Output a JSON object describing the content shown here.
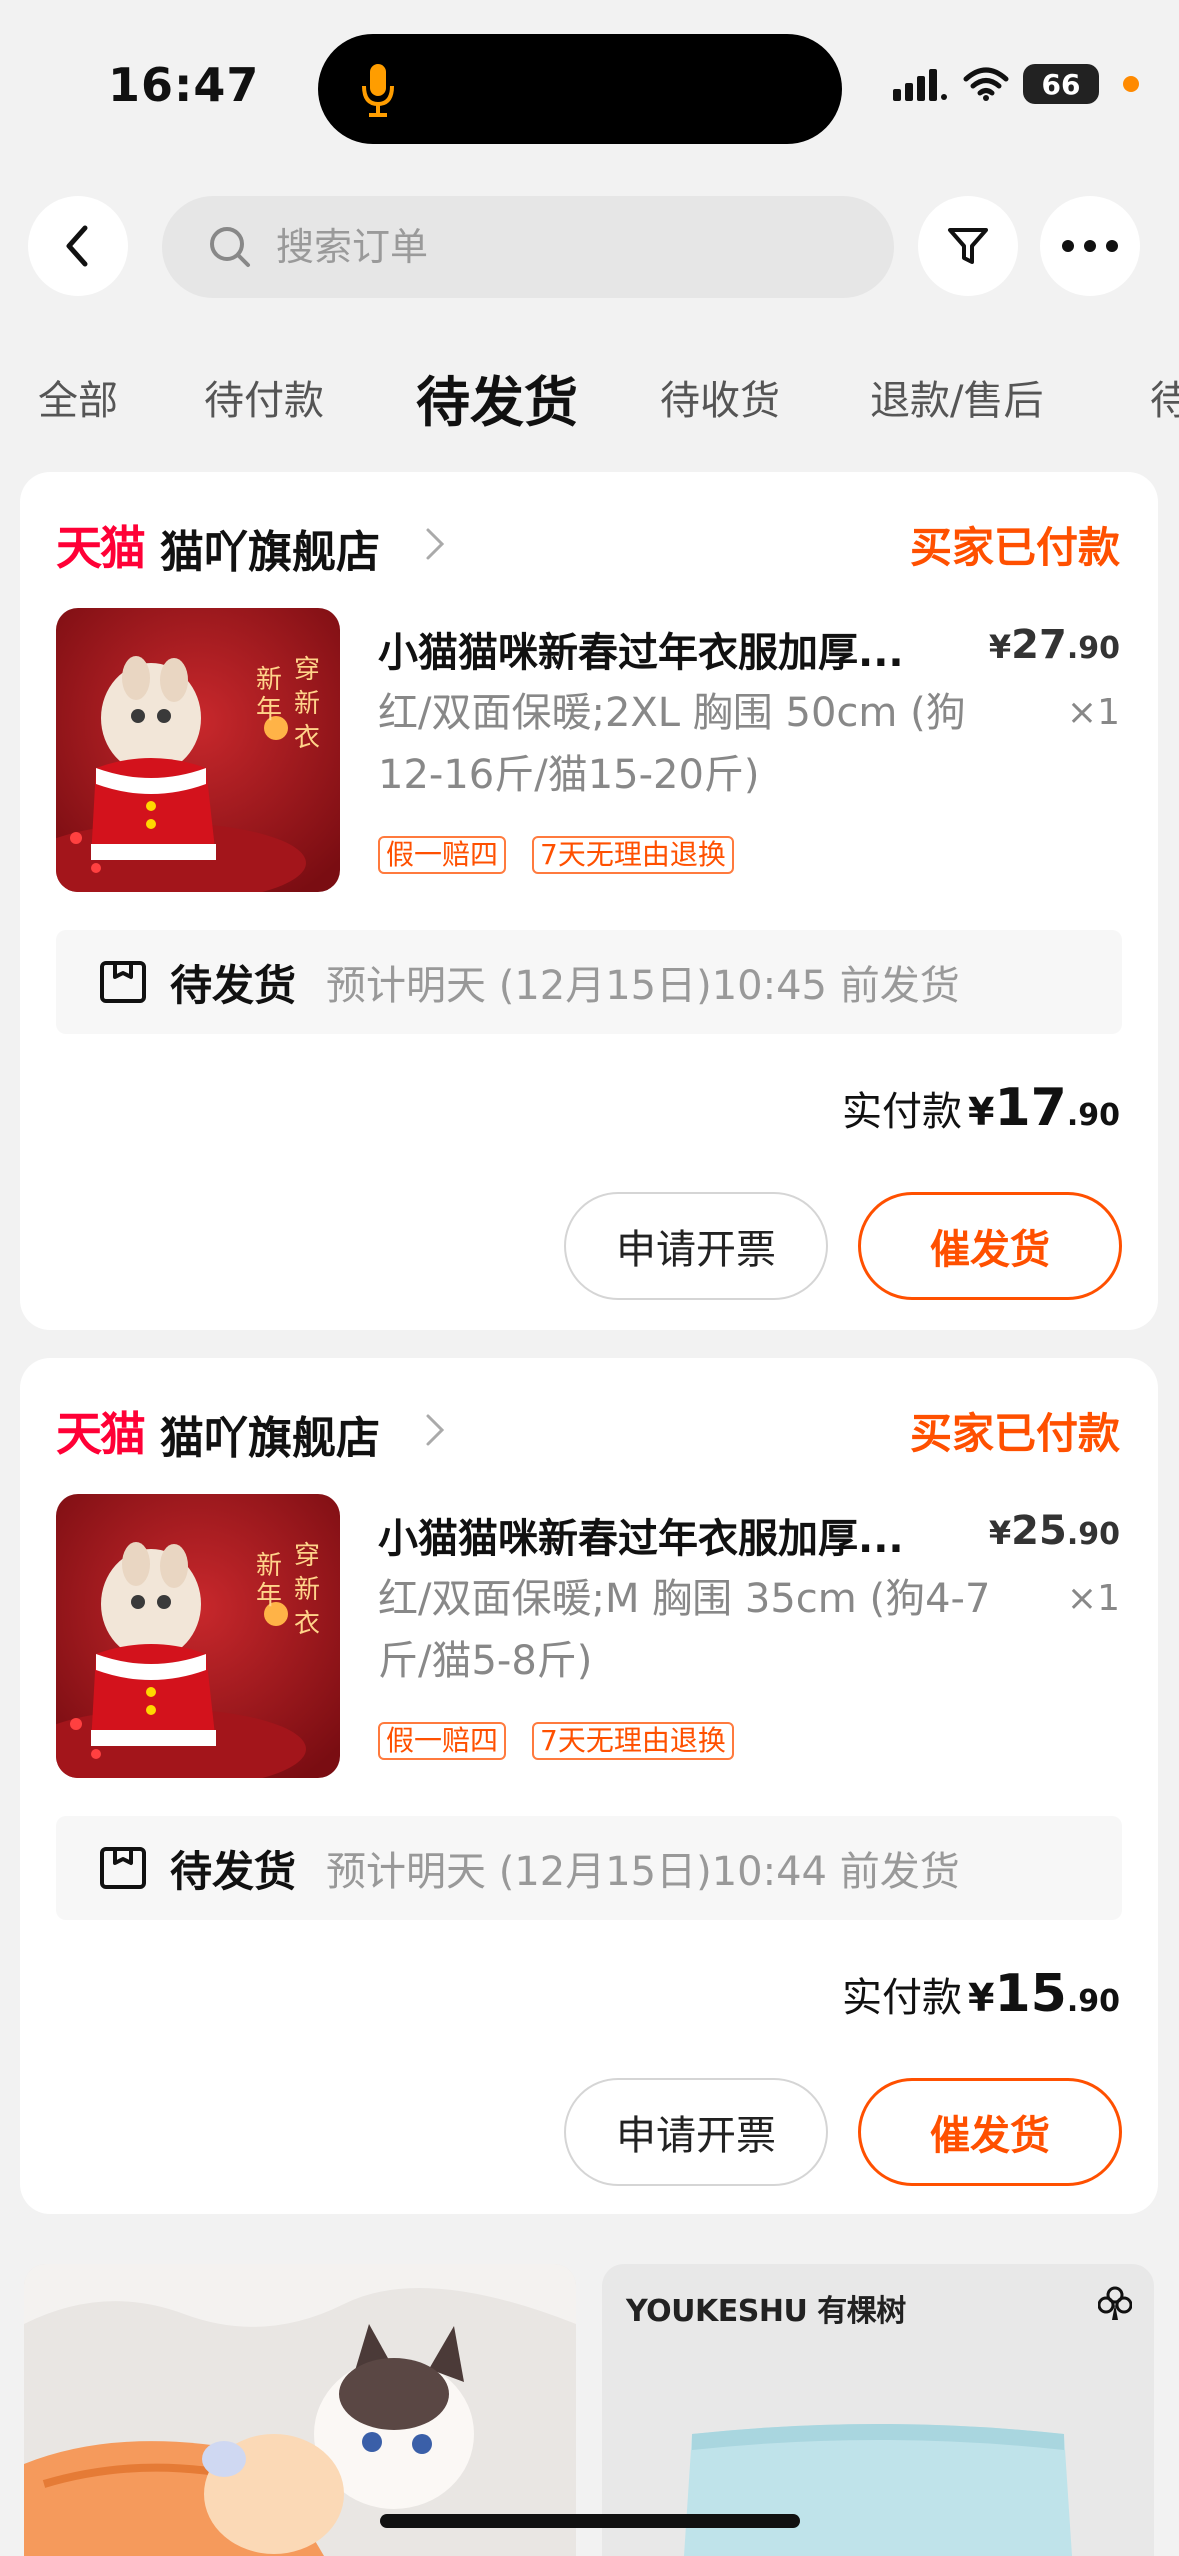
{
  "status_bar": {
    "time": "16:47",
    "battery": "66"
  },
  "search": {
    "placeholder": "搜索订单"
  },
  "tabs": [
    {
      "label": "全部"
    },
    {
      "label": "待付款"
    },
    {
      "label": "待发货"
    },
    {
      "label": "待收货"
    },
    {
      "label": "退款/售后"
    },
    {
      "label": "待"
    }
  ],
  "active_tab": "待发货",
  "orders": [
    {
      "store_logo": "天猫",
      "store_name": "猫吖旗舰店",
      "status": "买家已付款",
      "product_title": "小猫猫咪新春过年衣服加厚...",
      "price_int": "27",
      "price_dec": ".90",
      "sku": "红/双面保暖;2XL 胸围 50cm (狗12-16斤/猫15-20斤)",
      "qty": "×1",
      "tags": [
        "假一赔四",
        "7天无理由退换"
      ],
      "ship_label": "待发货",
      "ship_note": "预计明天 (12月15日)10:45 前发货",
      "paid_label": "实付款",
      "paid_int": "17",
      "paid_dec": ".90",
      "btn_invoice": "申请开票",
      "btn_urge": "催发货"
    },
    {
      "store_logo": "天猫",
      "store_name": "猫吖旗舰店",
      "status": "买家已付款",
      "product_title": "小猫猫咪新春过年衣服加厚...",
      "price_int": "25",
      "price_dec": ".90",
      "sku": "红/双面保暖;M 胸围 35cm (狗4-7斤/猫5-8斤)",
      "qty": "×1",
      "tags": [
        "假一赔四",
        "7天无理由退换"
      ],
      "ship_label": "待发货",
      "ship_note": "预计明天 (12月15日)10:44 前发货",
      "paid_label": "实付款",
      "paid_int": "15",
      "paid_dec": ".90",
      "btn_invoice": "申请开票",
      "btn_urge": "催发货"
    }
  ],
  "thumb_text": {
    "line1": "新年",
    "line2": "穿新衣"
  },
  "yen": "¥",
  "recommendations": [
    {
      "brand": ""
    },
    {
      "brand": "YOUKESHU 有棵树"
    }
  ],
  "colors": {
    "accent": "#ff5000",
    "tmall": "#ff0036"
  }
}
